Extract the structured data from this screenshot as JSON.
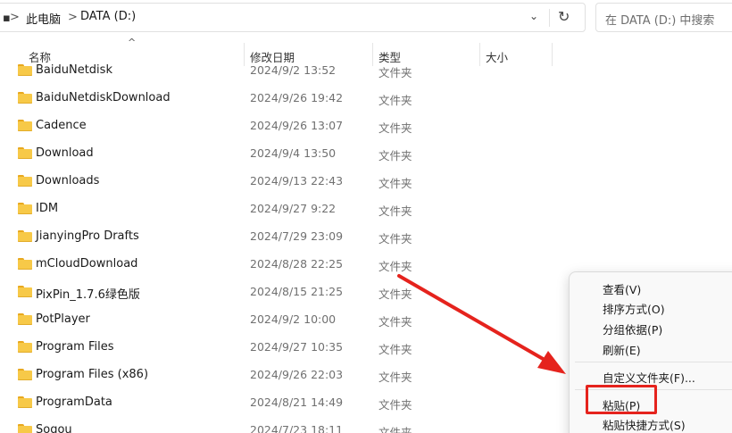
{
  "address_bar": {
    "crumbs": [
      "此电脑",
      "DATA (D:)"
    ],
    "separator": ">",
    "dropdown_glyph": "⌄",
    "refresh_glyph": "↻"
  },
  "search": {
    "placeholder": "在 DATA (D:) 中搜索"
  },
  "columns": {
    "name": "名称",
    "modified": "修改日期",
    "type": "类型",
    "size": "大小"
  },
  "sort_indicator": "^",
  "files": [
    {
      "name": "BaiduNetdisk",
      "modified": "2024/9/2 13:52",
      "type": "文件夹"
    },
    {
      "name": "BaiduNetdiskDownload",
      "modified": "2024/9/26 19:42",
      "type": "文件夹"
    },
    {
      "name": "Cadence",
      "modified": "2024/9/26 13:07",
      "type": "文件夹"
    },
    {
      "name": "Download",
      "modified": "2024/9/4 13:50",
      "type": "文件夹"
    },
    {
      "name": "Downloads",
      "modified": "2024/9/13 22:43",
      "type": "文件夹"
    },
    {
      "name": "IDM",
      "modified": "2024/9/27 9:22",
      "type": "文件夹"
    },
    {
      "name": "JianyingPro Drafts",
      "modified": "2024/7/29 23:09",
      "type": "文件夹"
    },
    {
      "name": "mCloudDownload",
      "modified": "2024/8/28 22:25",
      "type": "文件夹"
    },
    {
      "name": "PixPin_1.7.6绿色版",
      "modified": "2024/8/15 21:25",
      "type": "文件夹"
    },
    {
      "name": "PotPlayer",
      "modified": "2024/9/2 10:00",
      "type": "文件夹"
    },
    {
      "name": "Program Files",
      "modified": "2024/9/27 10:35",
      "type": "文件夹"
    },
    {
      "name": "Program Files (x86)",
      "modified": "2024/9/26 22:03",
      "type": "文件夹"
    },
    {
      "name": "ProgramData",
      "modified": "2024/8/21 14:49",
      "type": "文件夹"
    },
    {
      "name": "Sogou",
      "modified": "2024/7/23 18:11",
      "type": "文件夹"
    }
  ],
  "context_menu": {
    "view": "查看(V)",
    "sort": "排序方式(O)",
    "group": "分组依据(P)",
    "refresh": "刷新(E)",
    "customize": "自定义文件夹(F)...",
    "paste": "粘贴(P)",
    "paste_shortcut": "粘贴快捷方式(S)"
  },
  "colors": {
    "folder": "#f7c948",
    "annotation": "#e5231d"
  }
}
